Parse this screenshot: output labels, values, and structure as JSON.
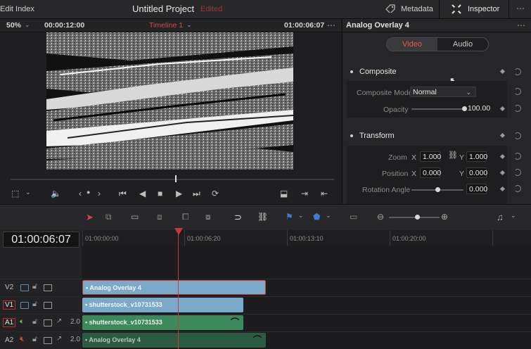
{
  "topbar": {
    "edit_index": "Edit Index",
    "project_title": "Untitled Project",
    "edited": "Edited",
    "metadata": "Metadata",
    "inspector": "Inspector"
  },
  "viewer": {
    "zoom": "50%",
    "duration": "00:00:12:00",
    "timeline_name": "Timeline 1",
    "timecode": "01:00:06:07",
    "scrub_position": 0.5
  },
  "inspector": {
    "clip_name": "Analog Overlay 4",
    "tabs": [
      "Video",
      "Audio"
    ],
    "active_tab": "Video",
    "composite": {
      "title": "Composite",
      "mode_label": "Composite Mode",
      "mode_value": "Normal",
      "opacity_label": "Opacity",
      "opacity_value": "100.00"
    },
    "transform": {
      "title": "Transform",
      "zoom_label": "Zoom",
      "zoom_x": "1.000",
      "zoom_y": "1.000",
      "position_label": "Position",
      "pos_x": "0.000",
      "pos_y": "0.000",
      "rotation_label": "Rotation Angle",
      "rotation_value": "0.000",
      "x_letter": "X",
      "y_letter": "Y"
    }
  },
  "timeline": {
    "timecode": "01:00:06:07",
    "ruler": [
      "01:00:00:00",
      "01:00:06:20",
      "01:00:13:10",
      "01:00:20:00"
    ],
    "tracks": [
      {
        "label": "V2",
        "clip": "Analog Overlay 4"
      },
      {
        "label": "V1",
        "clip": "shutterstock_v10731533"
      },
      {
        "label": "A1",
        "clip": "shutterstock_v10731533",
        "level": "2.0"
      },
      {
        "label": "A2",
        "clip": "Analog Overlay 4",
        "level": "2.0"
      }
    ]
  },
  "colors": {
    "accent_red": "#c83a3a",
    "video_clip": "#7aa9c9",
    "audio_clip": "#3c8a5c"
  }
}
